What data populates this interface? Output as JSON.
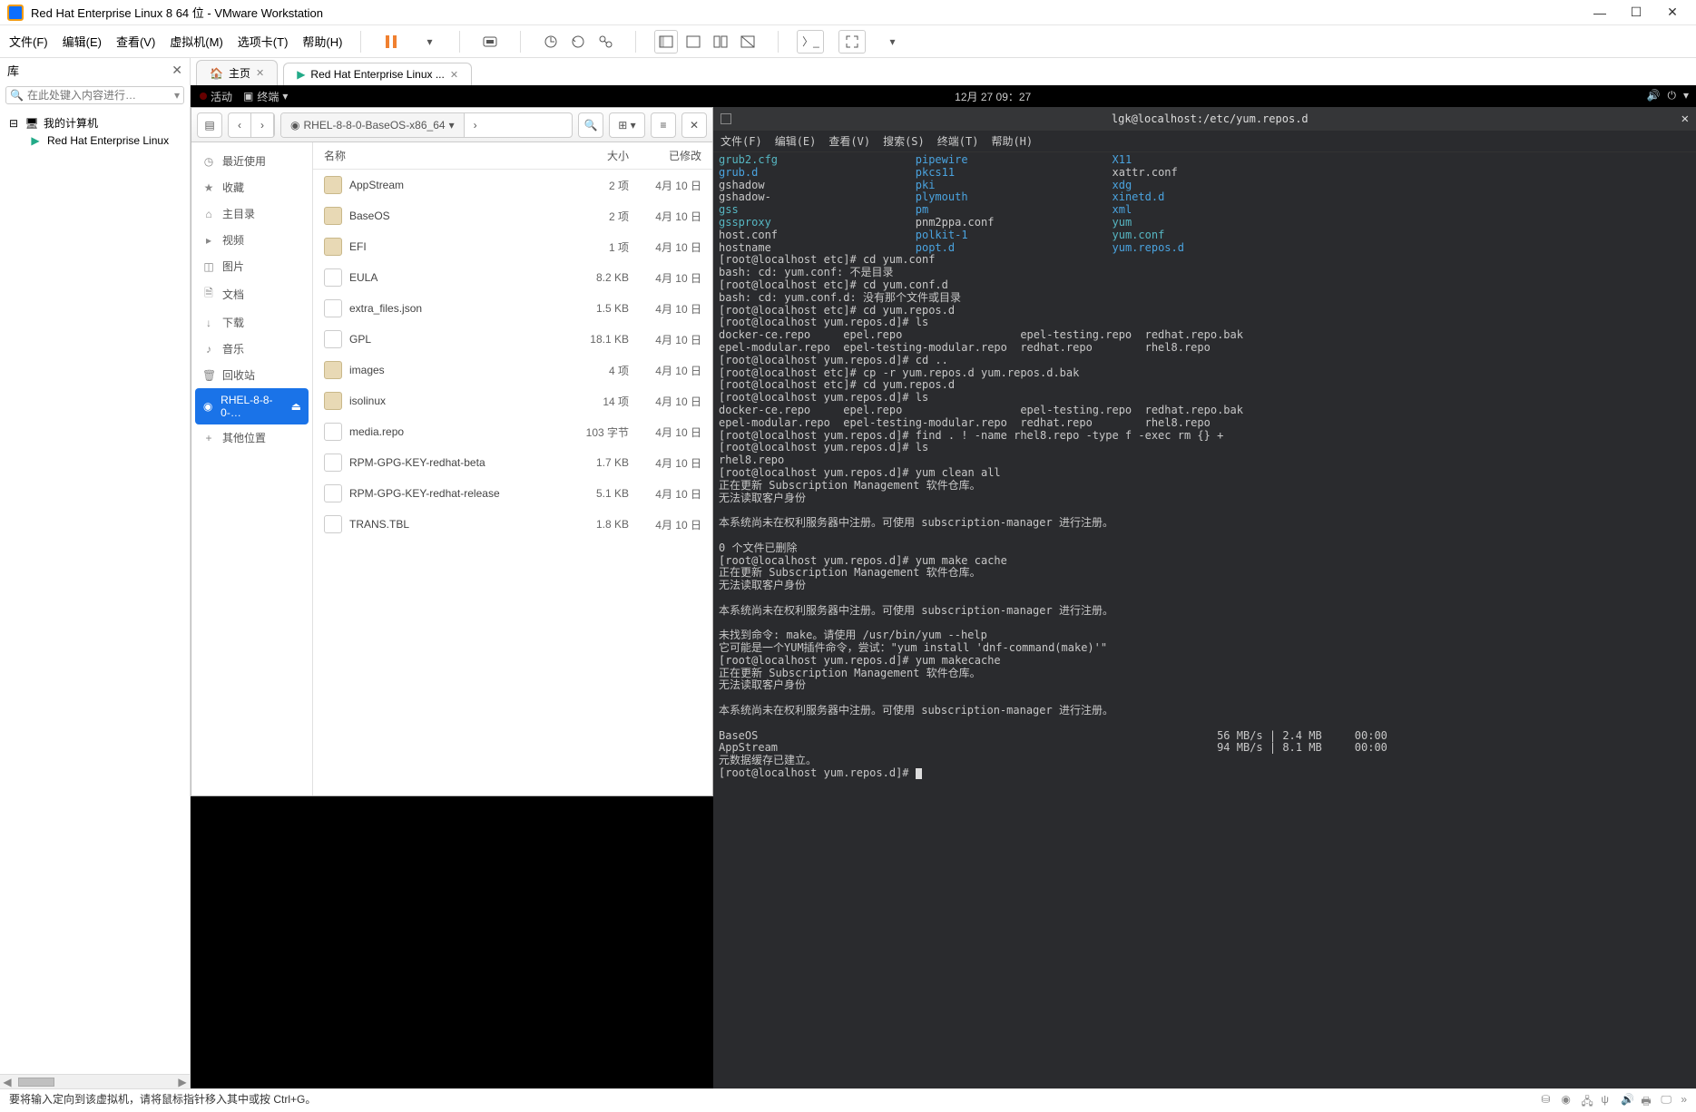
{
  "titlebar": {
    "title": "Red Hat Enterprise Linux 8 64 位 - VMware Workstation"
  },
  "menubar": {
    "items": [
      "文件(F)",
      "编辑(E)",
      "查看(V)",
      "虚拟机(M)",
      "选项卡(T)",
      "帮助(H)"
    ]
  },
  "library": {
    "title": "库",
    "search_placeholder": "在此处键入内容进行…",
    "root": "我的计算机",
    "child": "Red Hat Enterprise Linux"
  },
  "tabs": {
    "home": "主页",
    "vm": "Red Hat Enterprise Linux ..."
  },
  "gnome": {
    "activities": "活动",
    "terminal": "终端",
    "time": "12月 27  09：27"
  },
  "nautilus": {
    "path": "RHEL-8-8-0-BaseOS-x86_64",
    "cols": {
      "name": "名称",
      "size": "大小",
      "date": "已修改"
    },
    "sidebar": [
      {
        "label": "最近使用",
        "icon": "◷"
      },
      {
        "label": "收藏",
        "icon": "★"
      },
      {
        "label": "主目录",
        "icon": "⌂"
      },
      {
        "label": "视频",
        "icon": "▸"
      },
      {
        "label": "图片",
        "icon": "◫"
      },
      {
        "label": "文档",
        "icon": "🗎"
      },
      {
        "label": "下载",
        "icon": "↓"
      },
      {
        "label": "音乐",
        "icon": "♪"
      },
      {
        "label": "回收站",
        "icon": "🗑"
      },
      {
        "label": "RHEL-8-8-0-…",
        "icon": "◉",
        "active": true,
        "eject": "⏏"
      },
      {
        "label": "其他位置",
        "icon": "+"
      }
    ],
    "files": [
      {
        "name": "AppStream",
        "size": "2 项",
        "date": "4月 10 日",
        "type": "folder"
      },
      {
        "name": "BaseOS",
        "size": "2 项",
        "date": "4月 10 日",
        "type": "folder"
      },
      {
        "name": "EFI",
        "size": "1 项",
        "date": "4月 10 日",
        "type": "folder"
      },
      {
        "name": "EULA",
        "size": "8.2 KB",
        "date": "4月 10 日",
        "type": "file"
      },
      {
        "name": "extra_files.json",
        "size": "1.5 KB",
        "date": "4月 10 日",
        "type": "file"
      },
      {
        "name": "GPL",
        "size": "18.1 KB",
        "date": "4月 10 日",
        "type": "file"
      },
      {
        "name": "images",
        "size": "4 项",
        "date": "4月 10 日",
        "type": "folder"
      },
      {
        "name": "isolinux",
        "size": "14 项",
        "date": "4月 10 日",
        "type": "folder"
      },
      {
        "name": "media.repo",
        "size": "103 字节",
        "date": "4月 10 日",
        "type": "file"
      },
      {
        "name": "RPM-GPG-KEY-redhat-beta",
        "size": "1.7 KB",
        "date": "4月 10 日",
        "type": "file"
      },
      {
        "name": "RPM-GPG-KEY-redhat-release",
        "size": "5.1 KB",
        "date": "4月 10 日",
        "type": "file"
      },
      {
        "name": "TRANS.TBL",
        "size": "1.8 KB",
        "date": "4月 10 日",
        "type": "file"
      }
    ]
  },
  "terminal": {
    "title": "lgk@localhost:/etc/yum.repos.d",
    "menus": [
      "文件(F)",
      "编辑(E)",
      "查看(V)",
      "搜索(S)",
      "终端(T)",
      "帮助(H)"
    ],
    "listing": {
      "col1": [
        "grub2.cfg",
        "grub.d",
        "gshadow",
        "gshadow-",
        "gss",
        "gssproxy",
        "host.conf",
        "hostname"
      ],
      "col2": [
        "pipewire",
        "pkcs11",
        "pki",
        "plymouth",
        "pm",
        "pnm2ppa.conf",
        "polkit-1",
        "popt.d"
      ],
      "col3": [
        "X11",
        "xattr.conf",
        "xdg",
        "xinetd.d",
        "xml",
        "yum",
        "yum.conf",
        "yum.repos.d"
      ]
    },
    "colors": {
      "col1": [
        "cyan",
        "blue",
        "white",
        "white",
        "cyan",
        "cyan",
        "white",
        "white"
      ],
      "col2": [
        "blue",
        "blue",
        "blue",
        "blue",
        "blue",
        "white",
        "blue",
        "blue"
      ],
      "col3": [
        "blue",
        "white",
        "blue",
        "blue",
        "blue",
        "cyan",
        "cyan",
        "blue"
      ]
    },
    "lines": [
      "[root@localhost etc]# cd yum.conf",
      "bash: cd: yum.conf: 不是目录",
      "[root@localhost etc]# cd yum.conf.d",
      "bash: cd: yum.conf.d: 没有那个文件或目录",
      "[root@localhost etc]# cd yum.repos.d",
      "[root@localhost yum.repos.d]# ls",
      "docker-ce.repo     epel.repo                  epel-testing.repo  redhat.repo.bak",
      "epel-modular.repo  epel-testing-modular.repo  redhat.repo        rhel8.repo",
      "[root@localhost yum.repos.d]# cd ..",
      "[root@localhost etc]# cp -r yum.repos.d yum.repos.d.bak",
      "[root@localhost etc]# cd yum.repos.d",
      "[root@localhost yum.repos.d]# ls",
      "docker-ce.repo     epel.repo                  epel-testing.repo  redhat.repo.bak",
      "epel-modular.repo  epel-testing-modular.repo  redhat.repo        rhel8.repo",
      "[root@localhost yum.repos.d]# find . ! -name rhel8.repo -type f -exec rm {} +",
      "[root@localhost yum.repos.d]# ls",
      "rhel8.repo",
      "[root@localhost yum.repos.d]# yum clean all",
      "正在更新 Subscription Management 软件仓库。",
      "无法读取客户身份",
      "",
      "本系统尚未在权利服务器中注册。可使用 subscription-manager 进行注册。",
      "",
      "0 个文件已删除",
      "[root@localhost yum.repos.d]# yum make cache",
      "正在更新 Subscription Management 软件仓库。",
      "无法读取客户身份",
      "",
      "本系统尚未在权利服务器中注册。可使用 subscription-manager 进行注册。",
      "",
      "未找到命令: make。请使用 /usr/bin/yum --help",
      "它可能是一个YUM插件命令，尝试：\"yum install 'dnf-command(make)'\"",
      "[root@localhost yum.repos.d]# yum makecache",
      "正在更新 Subscription Management 软件仓库。",
      "无法读取客户身份",
      "",
      "本系统尚未在权利服务器中注册。可使用 subscription-manager 进行注册。",
      "",
      "BaseOS                                                                      56 MB/s | 2.4 MB     00:00",
      "AppStream                                                                   94 MB/s | 8.1 MB     00:00",
      "元数据缓存已建立。",
      "[root@localhost yum.repos.d]# "
    ]
  },
  "statusbar": {
    "text": "要将输入定向到该虚拟机，请将鼠标指针移入其中或按 Ctrl+G。"
  }
}
